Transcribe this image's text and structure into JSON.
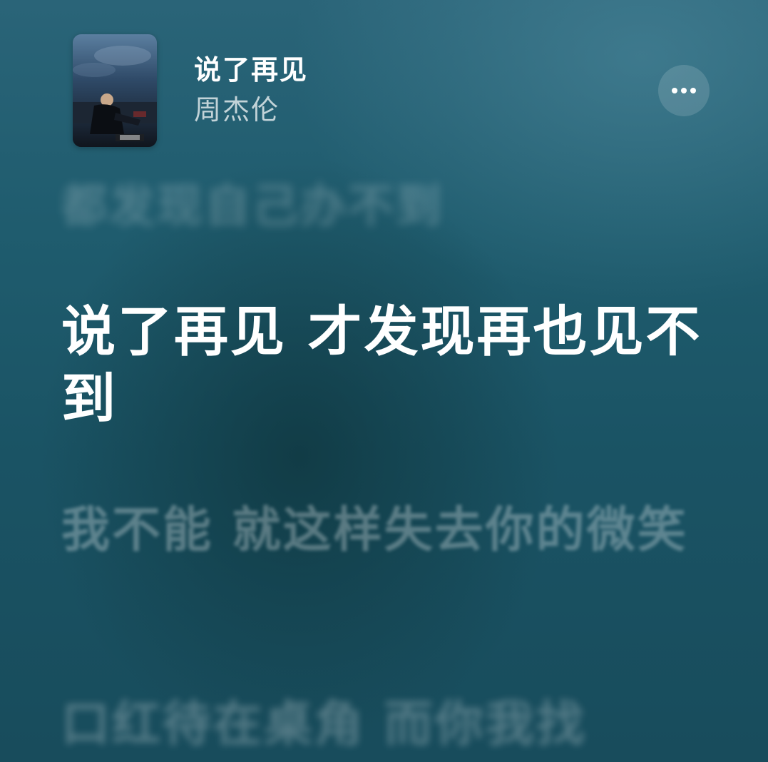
{
  "now_playing": {
    "title": "说了再见",
    "artist": "周杰伦",
    "album_art_icon": "album-cover",
    "more_icon": "ellipsis-icon"
  },
  "lyrics": {
    "previous": "都发现自己办不到",
    "current": "说了再见 才发现再也见不到",
    "next": "我不能 就这样失去你的微笑",
    "next2": "口红待在桌角 而你我找"
  },
  "colors": {
    "background": "#1f5c6e",
    "text_active": "#ffffff"
  }
}
